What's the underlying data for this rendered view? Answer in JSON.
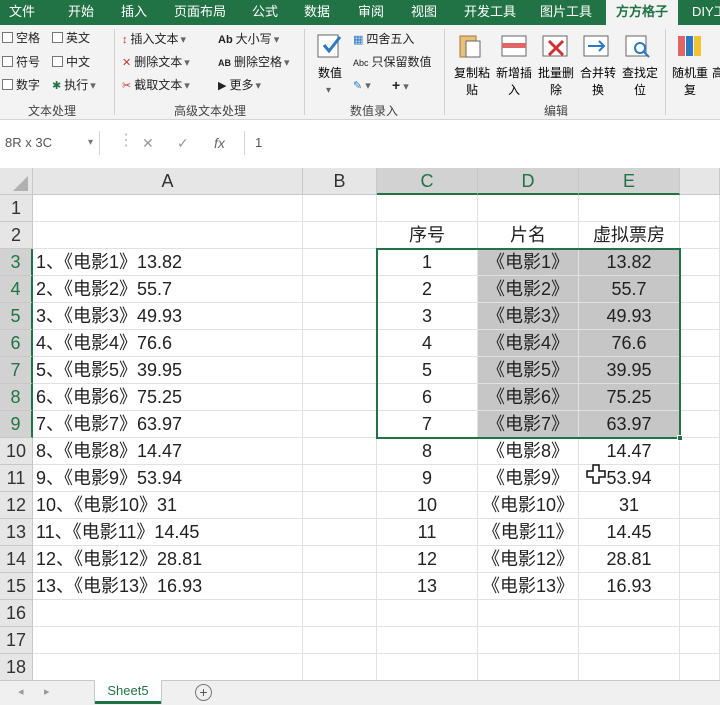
{
  "tabs": [
    "文件",
    "开始",
    "插入",
    "页面布局",
    "公式",
    "数据",
    "审阅",
    "视图",
    "开发工具",
    "图片工具",
    "方方格子",
    "DIY工"
  ],
  "ribbon": {
    "text_group": {
      "checks": [
        "空格",
        "英文",
        "符号",
        "中文",
        "数字"
      ],
      "exec_label": "执行",
      "label": "文本处理"
    },
    "adv_text_group": {
      "items": [
        "插入文本",
        "删除文本",
        "截取文本",
        "大小写",
        "删除空格",
        "更多"
      ],
      "label": "高级文本处理"
    },
    "number_group": {
      "value_label": "数值",
      "round_label": "四舍五入",
      "keep_label": "只保留数值",
      "label": "数值录入"
    },
    "edit_group": {
      "buttons": [
        "复制粘贴",
        "新增插入",
        "批量删除",
        "合并转换",
        "查找定位",
        "随机重复",
        "高"
      ],
      "label": "编辑"
    }
  },
  "formula_bar": {
    "name_box": "8R x 3C",
    "fx": "fx",
    "value": "1"
  },
  "columns": [
    "A",
    "B",
    "C",
    "D",
    "E"
  ],
  "rows": [
    "1",
    "2",
    "3",
    "4",
    "5",
    "6",
    "7",
    "8",
    "9",
    "10",
    "11",
    "12",
    "13",
    "14",
    "15",
    "16",
    "17",
    "18"
  ],
  "table_header": {
    "c": "序号",
    "d": "片名",
    "e": "虚拟票房"
  },
  "col_a": [
    "1、《电影1》13.82",
    "2、《电影2》55.7",
    "3、《电影3》49.93",
    "4、《电影4》76.6",
    "5、《电影5》39.95",
    "6、《电影6》75.25",
    "7、《电影7》63.97",
    "8、《电影8》14.47",
    "9、《电影9》53.94",
    "10、《电影10》31",
    "11、《电影11》14.45",
    "12、《电影12》28.81",
    "13、《电影13》16.93"
  ],
  "col_c": [
    "1",
    "2",
    "3",
    "4",
    "5",
    "6",
    "7",
    "8",
    "9",
    "10",
    "11",
    "12",
    "13"
  ],
  "col_d": [
    "《电影1》",
    "《电影2》",
    "《电影3》",
    "《电影4》",
    "《电影5》",
    "《电影6》",
    "《电影7》",
    "《电影8》",
    "《电影9》",
    "《电影10》",
    "《电影11》",
    "《电影12》",
    "《电影13》"
  ],
  "col_e": [
    "13.82",
    "55.7",
    "49.93",
    "76.6",
    "39.95",
    "75.25",
    "63.97",
    "14.47",
    "53.94",
    "31",
    "14.45",
    "28.81",
    "16.93"
  ],
  "sheet_tab": "Sheet5",
  "add_sheet": "+",
  "colors": {
    "accent": "#217346",
    "selection_fill": "#c6c6c6"
  }
}
